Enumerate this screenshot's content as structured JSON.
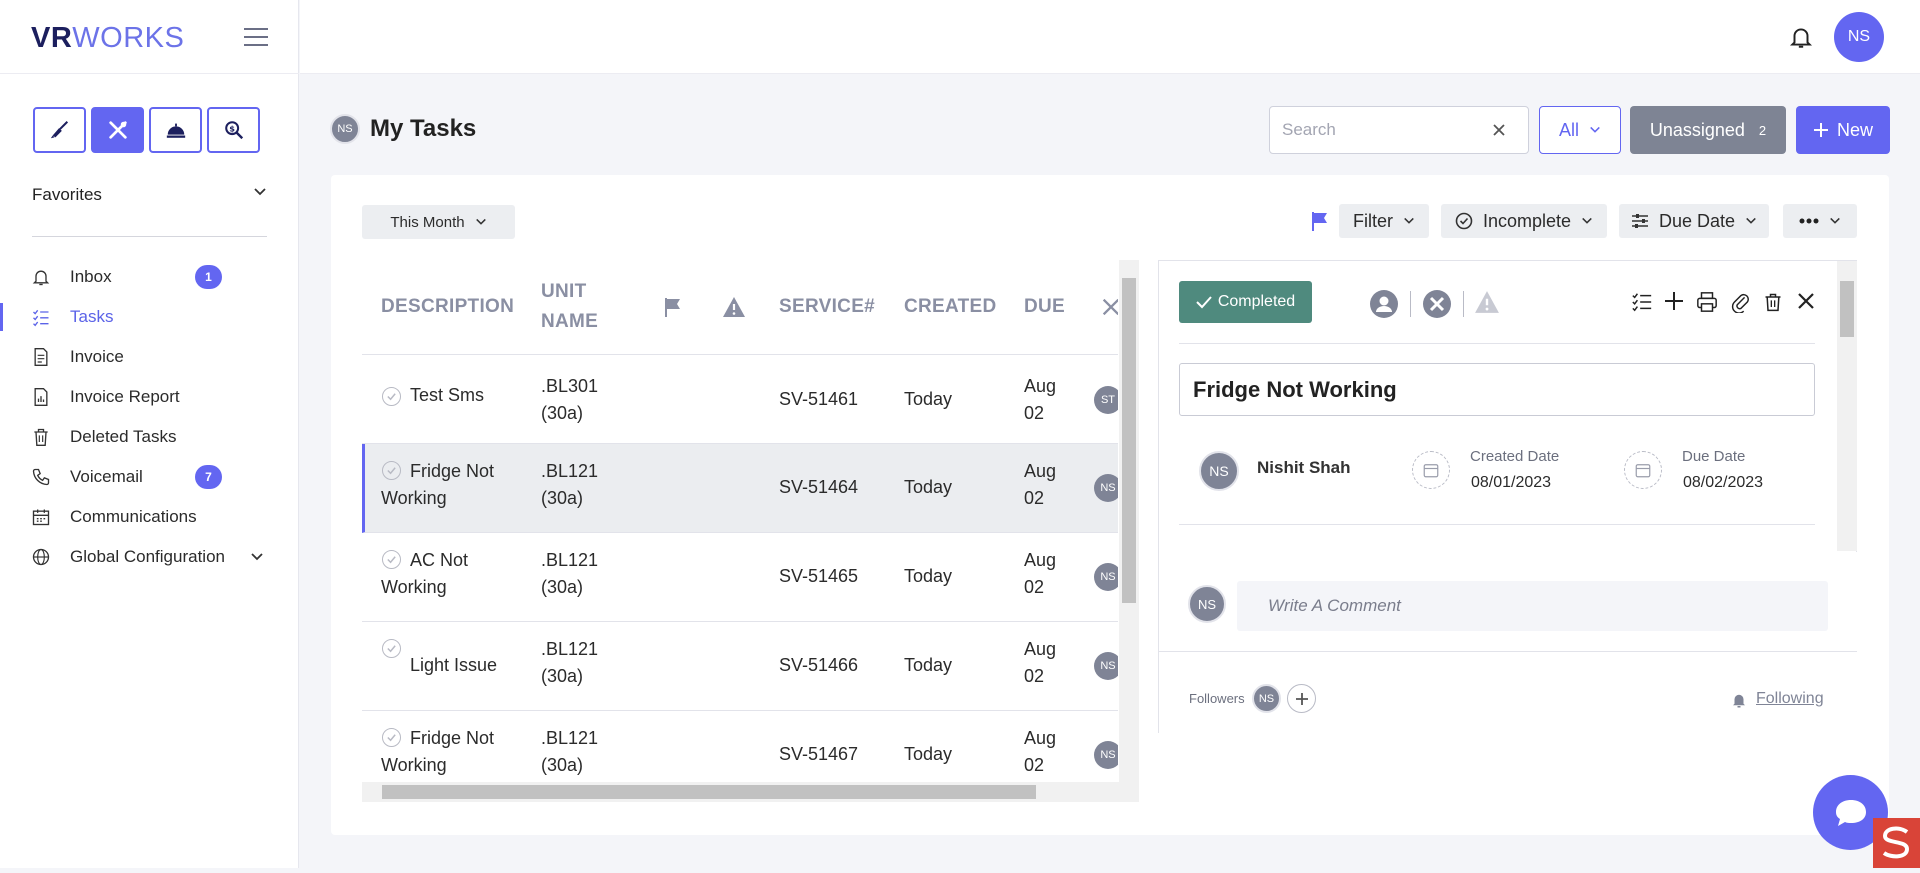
{
  "brand": {
    "part1": "VR",
    "part2": "WORKS"
  },
  "user": {
    "initials": "NS"
  },
  "sidebar": {
    "favorites_label": "Favorites",
    "items": [
      {
        "label": "Inbox",
        "badge": "1"
      },
      {
        "label": "Tasks"
      },
      {
        "label": "Invoice"
      },
      {
        "label": "Invoice Report"
      },
      {
        "label": "Deleted Tasks"
      },
      {
        "label": "Voicemail",
        "badge": "7"
      },
      {
        "label": "Communications"
      },
      {
        "label": "Global Configuration"
      }
    ]
  },
  "header": {
    "title": "My Tasks",
    "search_placeholder": "Search",
    "all_label": "All",
    "unassigned_label": "Unassigned",
    "unassigned_count": "2",
    "new_label": "New"
  },
  "toolbar": {
    "period": "This Month",
    "filter": "Filter",
    "status": "Incomplete",
    "sort": "Due Date"
  },
  "table": {
    "columns": [
      "DESCRIPTION",
      "UNIT",
      "NAME",
      "SERVICE#",
      "CREATED",
      "DUE"
    ],
    "rows": [
      {
        "desc1": "Test Sms",
        "desc2": "",
        "unit1": ".BL301",
        "unit2": "(30a)",
        "service": "SV-51461",
        "created": "Today",
        "due1": "Aug",
        "due2": "02",
        "assignee": "ST"
      },
      {
        "desc1": "Fridge Not",
        "desc2": "Working",
        "unit1": ".BL121",
        "unit2": "(30a)",
        "service": "SV-51464",
        "created": "Today",
        "due1": "Aug",
        "due2": "02",
        "assignee": "NS"
      },
      {
        "desc1": "AC Not",
        "desc2": "Working",
        "unit1": ".BL121",
        "unit2": "(30a)",
        "service": "SV-51465",
        "created": "Today",
        "due1": "Aug",
        "due2": "02",
        "assignee": "NS"
      },
      {
        "desc1": "Light Issue",
        "desc2": "",
        "unit1": ".BL121",
        "unit2": "(30a)",
        "service": "SV-51466",
        "created": "Today",
        "due1": "Aug",
        "due2": "02",
        "assignee": "NS"
      },
      {
        "desc1": "Fridge Not",
        "desc2": "Working",
        "unit1": ".BL121",
        "unit2": "(30a)",
        "service": "SV-51467",
        "created": "Today",
        "due1": "Aug",
        "due2": "02",
        "assignee": "NS"
      }
    ]
  },
  "detail": {
    "status_label": "Completed",
    "title": "Fridge Not Working",
    "assignee_name": "Nishit Shah",
    "created_label": "Created Date",
    "created_value": "08/01/2023",
    "due_label": "Due Date",
    "due_value": "08/02/2023",
    "comment_placeholder": "Write A Comment",
    "followers_label": "Followers",
    "following_label": "Following"
  },
  "colors": {
    "accent": "#6366f1",
    "completed": "#4f8a7e",
    "brand_dark": "#1c1f5e"
  }
}
